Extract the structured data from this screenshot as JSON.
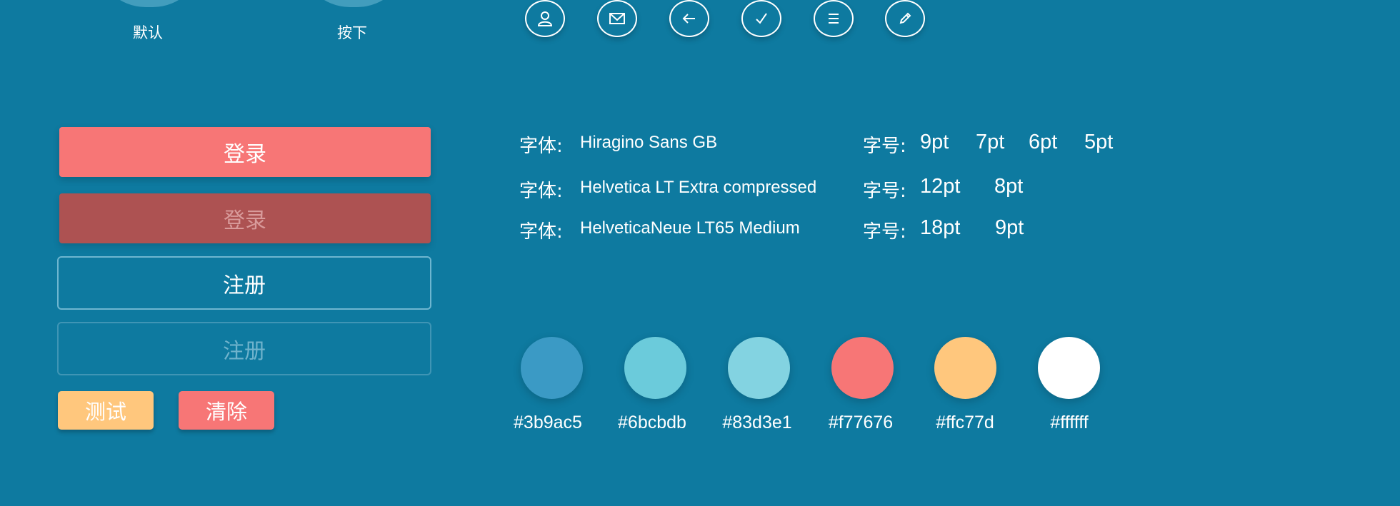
{
  "states": [
    {
      "label": "默认"
    },
    {
      "label": "按下"
    }
  ],
  "icons": [
    "user-icon",
    "mail-icon",
    "back-arrow-icon",
    "check-icon",
    "menu-icon",
    "edit-icon"
  ],
  "buttons": {
    "login": "登录",
    "login_disabled": "登录",
    "register": "注册",
    "register_disabled": "注册",
    "test": "测试",
    "clear": "清除"
  },
  "fonts": [
    {
      "label": "字体:",
      "name": "Hiragino Sans GB",
      "size_label": "字号:",
      "sizes": [
        "9pt",
        "7pt",
        "6pt",
        "5pt"
      ]
    },
    {
      "label": "字体:",
      "name": "Helvetica LT Extra compressed",
      "size_label": "字号:",
      "sizes": [
        "12pt",
        "8pt"
      ]
    },
    {
      "label": "字体:",
      "name": "HelveticaNeue LT65 Medium",
      "size_label": "字号:",
      "sizes": [
        "18pt",
        "9pt"
      ]
    }
  ],
  "colors": [
    {
      "hex": "#3b9ac5",
      "label": "#3b9ac5"
    },
    {
      "hex": "#6bcbdb",
      "label": "#6bcbdb"
    },
    {
      "hex": "#83d3e1",
      "label": "#83d3e1"
    },
    {
      "hex": "#f77676",
      "label": "#f77676"
    },
    {
      "hex": "#ffc77d",
      "label": "#ffc77d"
    },
    {
      "hex": "#ffffff",
      "label": "#ffffff"
    }
  ],
  "theme": {
    "background": "#0e7aa0"
  }
}
